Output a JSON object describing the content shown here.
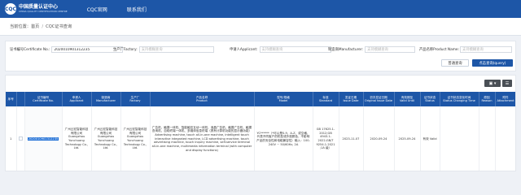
{
  "header": {
    "logo_badge": "CQC",
    "logo_cn": "中国质量认证中心",
    "logo_en": "CHINA QUALITY CERTIFICATION CENTRE",
    "nav": [
      "CQC官网",
      "联系我们"
    ]
  },
  "breadcrumb": {
    "prefix": "当前位置：",
    "home": "首页",
    "current": "CQC证书查询"
  },
  "search": {
    "cert_no_label": "证书编号Certificate No.:",
    "cert_no_value": "2020010901312235",
    "factory_label": "生产厂Factory:",
    "factory_placeholder": "支持模糊查询",
    "applicant_label": "申请人Applicant:",
    "applicant_placeholder": "支持模糊查询",
    "manufacturer_label": "制造商Manufacturer:",
    "manufacturer_placeholder": "支持模糊查询",
    "product_label": "产品名称Product Name:",
    "product_placeholder": "支持模糊查询",
    "btn_normal": "普通查询",
    "btn_query": "点击查询(query)"
  },
  "table": {
    "tools": [
      "▣ ▾",
      "☰"
    ],
    "headers": [
      {
        "cn": "序号",
        "en": ""
      },
      {
        "cn": "",
        "en": ""
      },
      {
        "cn": "证书编号",
        "en": "Certificate No."
      },
      {
        "cn": "申请人",
        "en": "Applicant"
      },
      {
        "cn": "制造商",
        "en": "Manufacturer"
      },
      {
        "cn": "生产厂",
        "en": "Factory"
      },
      {
        "cn": "产品名称",
        "en": "Product"
      },
      {
        "cn": "型号/规格",
        "en": "Model"
      },
      {
        "cn": "标准",
        "en": "Standard"
      },
      {
        "cn": "发证日期",
        "en": "Issue Date"
      },
      {
        "cn": "初次发证日期",
        "en": "Original Issue Date"
      },
      {
        "cn": "有效期至",
        "en": "Valid Until"
      },
      {
        "cn": "证书状态",
        "en": "Status"
      },
      {
        "cn": "证书状态变化时间",
        "en": "Status Changing Time"
      },
      {
        "cn": "原因",
        "en": "Reason"
      },
      {
        "cn": "附件",
        "en": "Attachment"
      }
    ],
    "row": {
      "index": "1",
      "cert_no": "2020010901312235",
      "applicant": "广州云宏智能科技有限公司 Guangzhou Yunchuang Technology Co., Ltd.",
      "manufacturer": "广州云宏智能科技有限公司 Guangzhou Yunchuang Technology Co., Ltd.",
      "factory": "广州云宏智能科技有限公司 Guangzhou Yunchuang Technology Co., Ltd.",
      "product": "广告机、触摸一体机、智能触控互动一体机、液晶广告机、触摸广告机、触摸查询机、自助终端一体机、多媒体信息终端（具有计算机功能的显示器功能） Advertising machine, touch all-in-one machine, intelligent touch interactive integrated machine, LCD advertising machine, touch advertising machine, touch inquiry machine, self-service terminal all-in-one machine, multimedia information terminal (with computer and display functions)",
      "model": "YC******（*可以是0-9、A-Z、或空格、代表不同客户的机型或外观颜色，不影响产品的安全性和电磁兼容性）输入：100-240V ~ 50/60Hz, 2A",
      "standard": "GB 17625.1-2012;GB 4943.1-2022;GB/T 9254.1-2021 ;1A 级）",
      "issue_date": "2023-11-07",
      "original_issue_date": "2020-09-24",
      "valid_until": "2025-09-24",
      "status": "有效 Valid",
      "status_change_time": "",
      "reason": "",
      "attachment": ""
    }
  }
}
